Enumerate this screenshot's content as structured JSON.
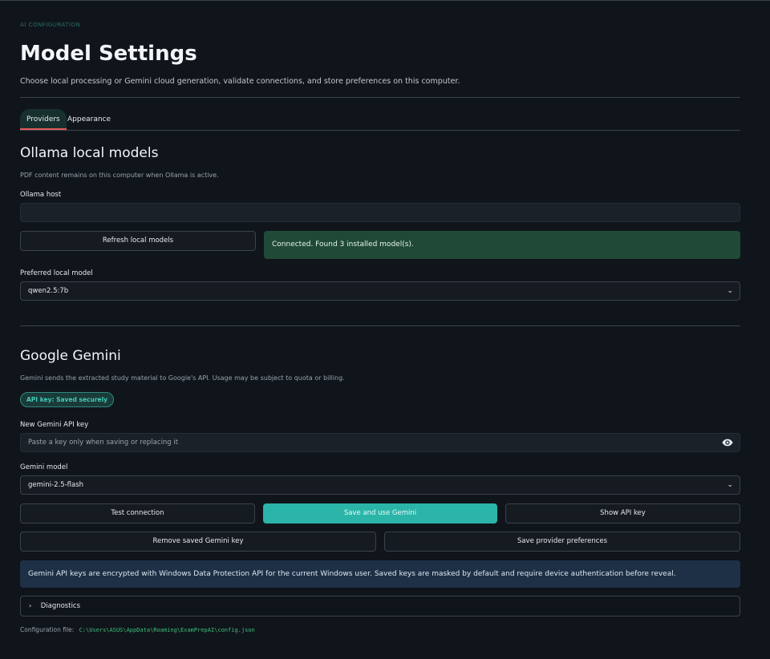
{
  "header": {
    "eyebrow": "AI CONFIGURATION",
    "title": "Model Settings",
    "subtitle": "Choose local processing or Gemini cloud generation, validate connections, and store preferences on this computer."
  },
  "tabs": [
    {
      "label": "Providers",
      "active": true
    },
    {
      "label": "Appearance",
      "active": false
    }
  ],
  "ollama": {
    "heading": "Ollama local models",
    "note": "PDF content remains on this computer when Ollama is active.",
    "host_label": "Ollama host",
    "host_value": "",
    "refresh_button": "Refresh local models",
    "status_message": "Connected. Found 3 installed model(s).",
    "model_label": "Preferred local model",
    "model_value": "qwen2.5:7b"
  },
  "gemini": {
    "heading": "Google Gemini",
    "note": "Gemini sends the extracted study material to Google's API. Usage may be subject to quota or billing.",
    "badge": "API key: Saved securely",
    "key_label": "New Gemini API key",
    "key_placeholder": "Paste a key only when saving or replacing it",
    "model_label": "Gemini model",
    "model_value": "gemini-2.5-flash",
    "test_button": "Test connection",
    "save_use_button": "Save and use Gemini",
    "show_key_button": "Show API key",
    "remove_button": "Remove saved Gemini key",
    "save_prefs_button": "Save provider preferences",
    "info": "Gemini API keys are encrypted with Windows Data Protection API for the current Windows user. Saved keys are masked by default and require device authentication before reveal."
  },
  "diagnostics": {
    "label": "Diagnostics"
  },
  "config": {
    "label": "Configuration file:",
    "path": "C:\\Users\\ASUS\\AppData\\Roaming\\ExamPrepAI\\config.json"
  },
  "icons": {
    "eye": "eye-icon",
    "chevron": "chevron-down-icon",
    "expander": "chevron-right-icon"
  },
  "colors": {
    "background": "#10151b",
    "accent": "#2bb5a9",
    "success": "#204a37",
    "info": "#1d3046",
    "tab_indicator": "#e05a5a"
  }
}
